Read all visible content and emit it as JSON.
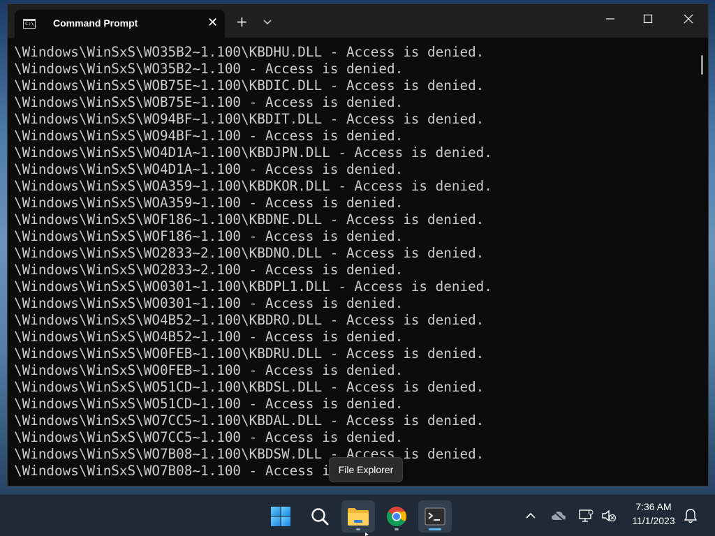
{
  "window": {
    "tab_title": "Command Prompt",
    "tab_icon_text": "C:\\_",
    "new_tab_symbol": "+",
    "close_tab_symbol": "✕"
  },
  "terminal": {
    "lines": [
      "\\Windows\\WinSxS\\WO35B2~1.100\\KBDHU.DLL - Access is denied.",
      "\\Windows\\WinSxS\\WO35B2~1.100 - Access is denied.",
      "\\Windows\\WinSxS\\WOB75E~1.100\\KBDIC.DLL - Access is denied.",
      "\\Windows\\WinSxS\\WOB75E~1.100 - Access is denied.",
      "\\Windows\\WinSxS\\WO94BF~1.100\\KBDIT.DLL - Access is denied.",
      "\\Windows\\WinSxS\\WO94BF~1.100 - Access is denied.",
      "\\Windows\\WinSxS\\WO4D1A~1.100\\KBDJPN.DLL - Access is denied.",
      "\\Windows\\WinSxS\\WO4D1A~1.100 - Access is denied.",
      "\\Windows\\WinSxS\\WOA359~1.100\\KBDKOR.DLL - Access is denied.",
      "\\Windows\\WinSxS\\WOA359~1.100 - Access is denied.",
      "\\Windows\\WinSxS\\WOF186~1.100\\KBDNE.DLL - Access is denied.",
      "\\Windows\\WinSxS\\WOF186~1.100 - Access is denied.",
      "\\Windows\\WinSxS\\WO2833~2.100\\KBDNO.DLL - Access is denied.",
      "\\Windows\\WinSxS\\WO2833~2.100 - Access is denied.",
      "\\Windows\\WinSxS\\WO0301~1.100\\KBDPL1.DLL - Access is denied.",
      "\\Windows\\WinSxS\\WO0301~1.100 - Access is denied.",
      "\\Windows\\WinSxS\\WO4B52~1.100\\KBDRO.DLL - Access is denied.",
      "\\Windows\\WinSxS\\WO4B52~1.100 - Access is denied.",
      "\\Windows\\WinSxS\\WO0FEB~1.100\\KBDRU.DLL - Access is denied.",
      "\\Windows\\WinSxS\\WO0FEB~1.100 - Access is denied.",
      "\\Windows\\WinSxS\\WO51CD~1.100\\KBDSL.DLL - Access is denied.",
      "\\Windows\\WinSxS\\WO51CD~1.100 - Access is denied.",
      "\\Windows\\WinSxS\\WO7CC5~1.100\\KBDAL.DLL - Access is denied.",
      "\\Windows\\WinSxS\\WO7CC5~1.100 - Access is denied.",
      "\\Windows\\WinSxS\\WO7B08~1.100\\KBDSW.DLL - Access is denied.",
      "\\Windows\\WinSxS\\WO7B08~1.100 - Access is denied."
    ],
    "text_color": "#cccccc",
    "background": "#0c0c0c"
  },
  "tooltip": {
    "text": "File Explorer"
  },
  "taskbar": {
    "apps": [
      {
        "name": "start",
        "icon": "windows-logo-icon"
      },
      {
        "name": "search",
        "icon": "search-icon"
      },
      {
        "name": "file-explorer",
        "icon": "folder-icon"
      },
      {
        "name": "chrome",
        "icon": "chrome-icon"
      },
      {
        "name": "terminal",
        "icon": "terminal-icon"
      }
    ],
    "accent": "#5bb8f5"
  },
  "tray": {
    "time": "7:36 AM",
    "date": "11/1/2023"
  }
}
